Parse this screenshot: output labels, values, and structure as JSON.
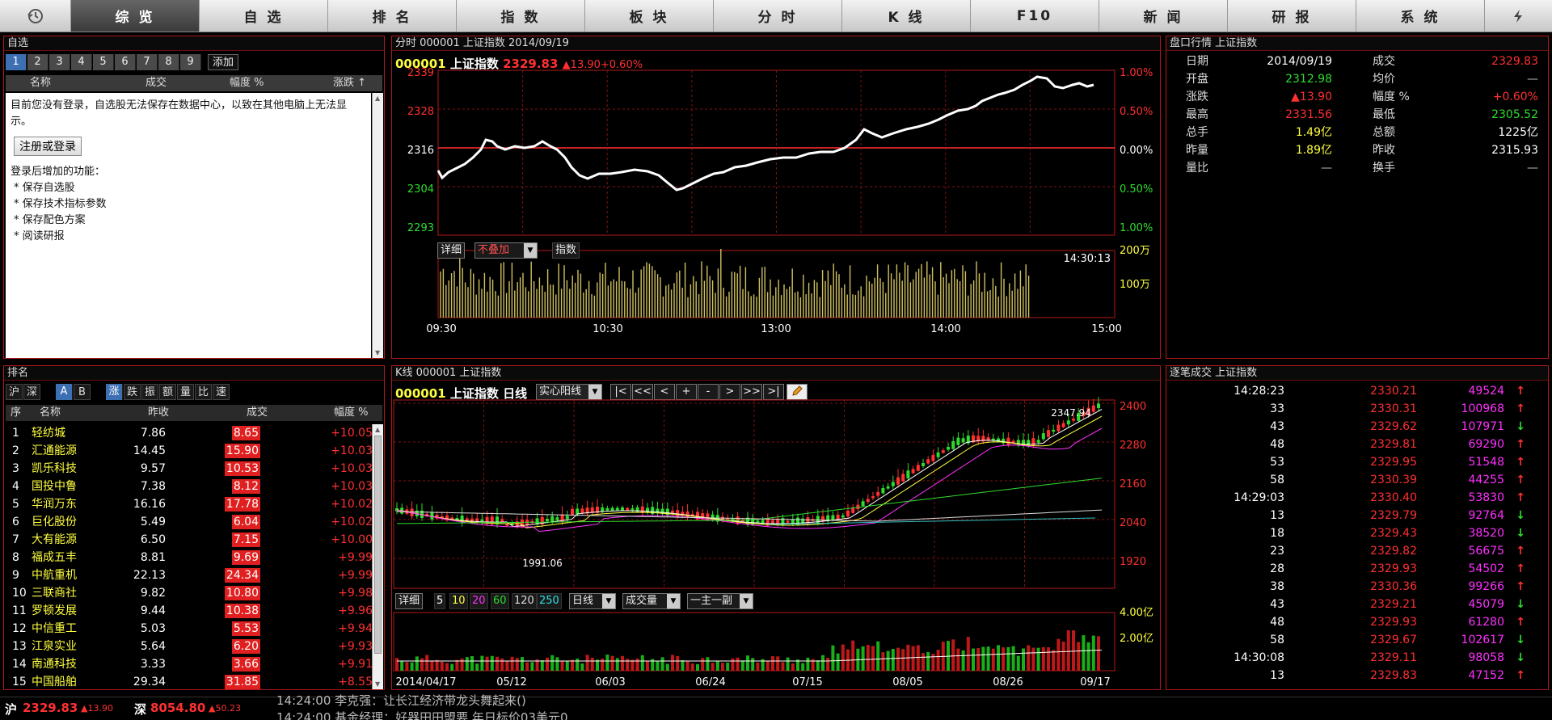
{
  "nav": {
    "history_icon": "history-clock-icon",
    "items": [
      "综 览",
      "自 选",
      "排 名",
      "指 数",
      "板 块",
      "分 时",
      "K 线",
      "F10",
      "新 闻",
      "研 报",
      "系 统"
    ],
    "active_index": 0,
    "flash_icon": "lightning-icon"
  },
  "watchlist": {
    "title": "自选",
    "tabs": [
      "1",
      "2",
      "3",
      "4",
      "5",
      "6",
      "7",
      "8",
      "9"
    ],
    "add_label": "添加",
    "headers": {
      "name": "名称",
      "vol": "成交",
      "pct": "幅度 %",
      "change": "涨跌 ↑"
    },
    "msg1": "目前您没有登录，自选股无法保存在数据中心，以致在其他电脑上无法显示。",
    "register_label": "注册或登录",
    "features_title": "登录后增加的功能：",
    "features": [
      "* 保存自选股",
      "* 保存技术指标参数",
      "* 保存配色方案",
      "* 阅读研报"
    ]
  },
  "intraday": {
    "title": "分时 000001 上证指数 2014/09/19",
    "code": "000001",
    "name": "上证指数",
    "price": "2329.83",
    "change": "▲13.90",
    "pct": "+0.60%",
    "left_axis": [
      "2339",
      "2328",
      "2316",
      "2304",
      "2293"
    ],
    "right_axis": [
      "1.00%",
      "0.50%",
      "0.00%",
      "0.50%",
      "1.00%"
    ],
    "btn_detail": "详细",
    "btn_overlay": "不叠加",
    "btn_index": "指数",
    "time_label": "14:30:13",
    "vol_axis": [
      "200万",
      "100万"
    ],
    "time_axis": [
      "09:30",
      "10:30",
      "13:00",
      "14:00",
      "15:00"
    ]
  },
  "quote": {
    "title": "盘口行情 上证指数",
    "rows": [
      {
        "l1": "日期",
        "v1": "2014/09/19",
        "c1": "white",
        "l2": "成交",
        "v2": "2329.83",
        "c2": "red"
      },
      {
        "l1": "开盘",
        "v1": "2312.98",
        "c1": "green",
        "l2": "均价",
        "v2": "—",
        "c2": "gray"
      },
      {
        "l1": "涨跌",
        "v1": "▲13.90",
        "c1": "red",
        "l2": "幅度 %",
        "v2": "+0.60%",
        "c2": "red"
      },
      {
        "l1": "最高",
        "v1": "2331.56",
        "c1": "red",
        "l2": "最低",
        "v2": "2305.52",
        "c2": "green"
      },
      {
        "l1": "总手",
        "v1": "1.49亿",
        "c1": "yellow",
        "l2": "总额",
        "v2": "1225亿",
        "c2": "white"
      },
      {
        "l1": "昨量",
        "v1": "1.89亿",
        "c1": "yellow",
        "l2": "昨收",
        "v2": "2315.93",
        "c2": "white"
      },
      {
        "l1": "量比",
        "v1": "—",
        "c1": "gray",
        "l2": "换手",
        "v2": "—",
        "c2": "gray"
      }
    ]
  },
  "ranking": {
    "title": "排名",
    "tabs": [
      "沪",
      "深",
      "A",
      "B",
      "涨",
      "跌",
      "振",
      "额",
      "量",
      "比",
      "速"
    ],
    "headers": {
      "seq": "序",
      "name": "名称",
      "prev": "昨收",
      "vol": "成交",
      "pct": "幅度 %"
    },
    "rows": [
      [
        "1",
        "轻纺城",
        "7.86",
        "8.65",
        "+10.05"
      ],
      [
        "2",
        "汇通能源",
        "14.45",
        "15.90",
        "+10.03"
      ],
      [
        "3",
        "凯乐科技",
        "9.57",
        "10.53",
        "+10.03"
      ],
      [
        "4",
        "国投中鲁",
        "7.38",
        "8.12",
        "+10.03"
      ],
      [
        "5",
        "华润万东",
        "16.16",
        "17.78",
        "+10.02"
      ],
      [
        "6",
        "巨化股份",
        "5.49",
        "6.04",
        "+10.02"
      ],
      [
        "7",
        "大有能源",
        "6.50",
        "7.15",
        "+10.00"
      ],
      [
        "8",
        "福成五丰",
        "8.81",
        "9.69",
        "+9.99"
      ],
      [
        "9",
        "中航重机",
        "22.13",
        "24.34",
        "+9.99"
      ],
      [
        "10",
        "三联商社",
        "9.82",
        "10.80",
        "+9.98"
      ],
      [
        "11",
        "罗顿发展",
        "9.44",
        "10.38",
        "+9.96"
      ],
      [
        "12",
        "中信重工",
        "5.03",
        "5.53",
        "+9.94"
      ],
      [
        "13",
        "江泉实业",
        "5.64",
        "6.20",
        "+9.93"
      ],
      [
        "14",
        "南通科技",
        "3.33",
        "3.66",
        "+9.91"
      ],
      [
        "15",
        "中国船舶",
        "29.34",
        "31.85",
        "+8.55"
      ]
    ]
  },
  "kline": {
    "title": "K线 000001 上证指数",
    "code": "000001",
    "name": "上证指数 日线",
    "style_select": "实心阳线",
    "nav_buttons": [
      "|<",
      "<<",
      "<",
      "+",
      "-",
      ">",
      ">>",
      ">|"
    ],
    "pencil_icon": "pencil-icon",
    "price_axis": [
      "2400",
      "2280",
      "2160",
      "2040",
      "1920"
    ],
    "high_label": "2347.94",
    "low_label": "1991.06",
    "btn_detail": "详细",
    "ma_periods": [
      "5",
      "10",
      "20",
      "60",
      "120",
      "250"
    ],
    "period_select": "日线",
    "indicator_select": "成交量",
    "layout_select": "一主一副",
    "vol_axis": [
      "4.00亿",
      "2.00亿"
    ],
    "date_axis": [
      "2014/04/17",
      "05/12",
      "06/03",
      "06/24",
      "07/15",
      "08/05",
      "08/26",
      "09/17"
    ]
  },
  "ticks": {
    "title": "逐笔成交 上证指数",
    "rows": [
      [
        "14:28:23",
        "2330.21",
        "49524",
        "up"
      ],
      [
        "33",
        "2330.31",
        "100968",
        "up"
      ],
      [
        "43",
        "2329.62",
        "107971",
        "down"
      ],
      [
        "48",
        "2329.81",
        "69290",
        "up"
      ],
      [
        "53",
        "2329.95",
        "51548",
        "up"
      ],
      [
        "58",
        "2330.39",
        "44255",
        "up"
      ],
      [
        "14:29:03",
        "2330.40",
        "53830",
        "up"
      ],
      [
        "13",
        "2329.79",
        "92764",
        "down"
      ],
      [
        "18",
        "2329.43",
        "38520",
        "down"
      ],
      [
        "23",
        "2329.82",
        "56675",
        "up"
      ],
      [
        "28",
        "2329.93",
        "54502",
        "up"
      ],
      [
        "38",
        "2330.36",
        "99266",
        "up"
      ],
      [
        "43",
        "2329.21",
        "45079",
        "down"
      ],
      [
        "48",
        "2329.93",
        "61280",
        "up"
      ],
      [
        "58",
        "2329.67",
        "102617",
        "down"
      ],
      [
        "14:30:08",
        "2329.11",
        "98058",
        "down"
      ],
      [
        "13",
        "2329.83",
        "47152",
        "up"
      ]
    ]
  },
  "statusbar": {
    "sh_label": "沪",
    "sh_price": "2329.83",
    "sh_change": "▲13.90",
    "sz_label": "深",
    "sz_price": "8054.80",
    "sz_change": "▲50.23",
    "news1": "14:24:00 李克强：让长江经济带龙头舞起来()",
    "news2": "14:24:00 基金经理：好器田田盟要 年日标价03美元0"
  }
}
